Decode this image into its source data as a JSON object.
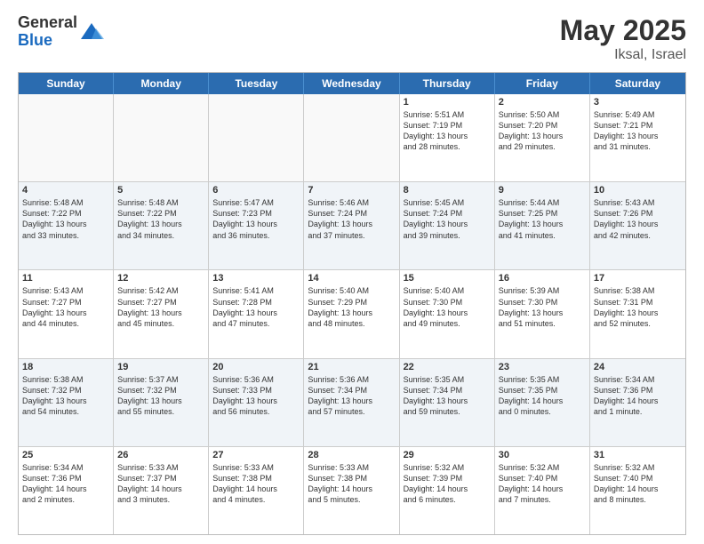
{
  "logo": {
    "general": "General",
    "blue": "Blue"
  },
  "header": {
    "month": "May 2025",
    "location": "Iksal, Israel"
  },
  "days": [
    "Sunday",
    "Monday",
    "Tuesday",
    "Wednesday",
    "Thursday",
    "Friday",
    "Saturday"
  ],
  "rows": [
    [
      {
        "day": "",
        "empty": true
      },
      {
        "day": "",
        "empty": true
      },
      {
        "day": "",
        "empty": true
      },
      {
        "day": "",
        "empty": true
      },
      {
        "day": "1",
        "lines": [
          "Sunrise: 5:51 AM",
          "Sunset: 7:19 PM",
          "Daylight: 13 hours",
          "and 28 minutes."
        ]
      },
      {
        "day": "2",
        "lines": [
          "Sunrise: 5:50 AM",
          "Sunset: 7:20 PM",
          "Daylight: 13 hours",
          "and 29 minutes."
        ]
      },
      {
        "day": "3",
        "lines": [
          "Sunrise: 5:49 AM",
          "Sunset: 7:21 PM",
          "Daylight: 13 hours",
          "and 31 minutes."
        ]
      }
    ],
    [
      {
        "day": "4",
        "lines": [
          "Sunrise: 5:48 AM",
          "Sunset: 7:22 PM",
          "Daylight: 13 hours",
          "and 33 minutes."
        ]
      },
      {
        "day": "5",
        "lines": [
          "Sunrise: 5:48 AM",
          "Sunset: 7:22 PM",
          "Daylight: 13 hours",
          "and 34 minutes."
        ]
      },
      {
        "day": "6",
        "lines": [
          "Sunrise: 5:47 AM",
          "Sunset: 7:23 PM",
          "Daylight: 13 hours",
          "and 36 minutes."
        ]
      },
      {
        "day": "7",
        "lines": [
          "Sunrise: 5:46 AM",
          "Sunset: 7:24 PM",
          "Daylight: 13 hours",
          "and 37 minutes."
        ]
      },
      {
        "day": "8",
        "lines": [
          "Sunrise: 5:45 AM",
          "Sunset: 7:24 PM",
          "Daylight: 13 hours",
          "and 39 minutes."
        ]
      },
      {
        "day": "9",
        "lines": [
          "Sunrise: 5:44 AM",
          "Sunset: 7:25 PM",
          "Daylight: 13 hours",
          "and 41 minutes."
        ]
      },
      {
        "day": "10",
        "lines": [
          "Sunrise: 5:43 AM",
          "Sunset: 7:26 PM",
          "Daylight: 13 hours",
          "and 42 minutes."
        ]
      }
    ],
    [
      {
        "day": "11",
        "lines": [
          "Sunrise: 5:43 AM",
          "Sunset: 7:27 PM",
          "Daylight: 13 hours",
          "and 44 minutes."
        ]
      },
      {
        "day": "12",
        "lines": [
          "Sunrise: 5:42 AM",
          "Sunset: 7:27 PM",
          "Daylight: 13 hours",
          "and 45 minutes."
        ]
      },
      {
        "day": "13",
        "lines": [
          "Sunrise: 5:41 AM",
          "Sunset: 7:28 PM",
          "Daylight: 13 hours",
          "and 47 minutes."
        ]
      },
      {
        "day": "14",
        "lines": [
          "Sunrise: 5:40 AM",
          "Sunset: 7:29 PM",
          "Daylight: 13 hours",
          "and 48 minutes."
        ]
      },
      {
        "day": "15",
        "lines": [
          "Sunrise: 5:40 AM",
          "Sunset: 7:30 PM",
          "Daylight: 13 hours",
          "and 49 minutes."
        ]
      },
      {
        "day": "16",
        "lines": [
          "Sunrise: 5:39 AM",
          "Sunset: 7:30 PM",
          "Daylight: 13 hours",
          "and 51 minutes."
        ]
      },
      {
        "day": "17",
        "lines": [
          "Sunrise: 5:38 AM",
          "Sunset: 7:31 PM",
          "Daylight: 13 hours",
          "and 52 minutes."
        ]
      }
    ],
    [
      {
        "day": "18",
        "lines": [
          "Sunrise: 5:38 AM",
          "Sunset: 7:32 PM",
          "Daylight: 13 hours",
          "and 54 minutes."
        ]
      },
      {
        "day": "19",
        "lines": [
          "Sunrise: 5:37 AM",
          "Sunset: 7:32 PM",
          "Daylight: 13 hours",
          "and 55 minutes."
        ]
      },
      {
        "day": "20",
        "lines": [
          "Sunrise: 5:36 AM",
          "Sunset: 7:33 PM",
          "Daylight: 13 hours",
          "and 56 minutes."
        ]
      },
      {
        "day": "21",
        "lines": [
          "Sunrise: 5:36 AM",
          "Sunset: 7:34 PM",
          "Daylight: 13 hours",
          "and 57 minutes."
        ]
      },
      {
        "day": "22",
        "lines": [
          "Sunrise: 5:35 AM",
          "Sunset: 7:34 PM",
          "Daylight: 13 hours",
          "and 59 minutes."
        ]
      },
      {
        "day": "23",
        "lines": [
          "Sunrise: 5:35 AM",
          "Sunset: 7:35 PM",
          "Daylight: 14 hours",
          "and 0 minutes."
        ]
      },
      {
        "day": "24",
        "lines": [
          "Sunrise: 5:34 AM",
          "Sunset: 7:36 PM",
          "Daylight: 14 hours",
          "and 1 minute."
        ]
      }
    ],
    [
      {
        "day": "25",
        "lines": [
          "Sunrise: 5:34 AM",
          "Sunset: 7:36 PM",
          "Daylight: 14 hours",
          "and 2 minutes."
        ]
      },
      {
        "day": "26",
        "lines": [
          "Sunrise: 5:33 AM",
          "Sunset: 7:37 PM",
          "Daylight: 14 hours",
          "and 3 minutes."
        ]
      },
      {
        "day": "27",
        "lines": [
          "Sunrise: 5:33 AM",
          "Sunset: 7:38 PM",
          "Daylight: 14 hours",
          "and 4 minutes."
        ]
      },
      {
        "day": "28",
        "lines": [
          "Sunrise: 5:33 AM",
          "Sunset: 7:38 PM",
          "Daylight: 14 hours",
          "and 5 minutes."
        ]
      },
      {
        "day": "29",
        "lines": [
          "Sunrise: 5:32 AM",
          "Sunset: 7:39 PM",
          "Daylight: 14 hours",
          "and 6 minutes."
        ]
      },
      {
        "day": "30",
        "lines": [
          "Sunrise: 5:32 AM",
          "Sunset: 7:40 PM",
          "Daylight: 14 hours",
          "and 7 minutes."
        ]
      },
      {
        "day": "31",
        "lines": [
          "Sunrise: 5:32 AM",
          "Sunset: 7:40 PM",
          "Daylight: 14 hours",
          "and 8 minutes."
        ]
      }
    ]
  ]
}
